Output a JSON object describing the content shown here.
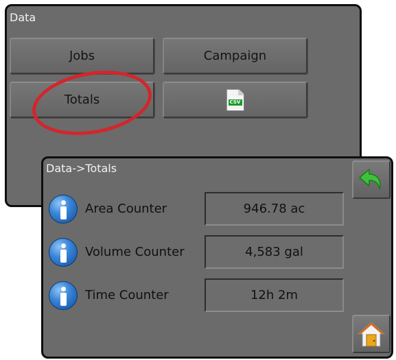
{
  "data_panel": {
    "title": "Data",
    "buttons": {
      "jobs": "Jobs",
      "campaign": "Campaign",
      "totals": "Totals",
      "export": {
        "icon": "csv-file-icon",
        "badge": "CSV"
      }
    },
    "highlight": {
      "target": "Totals",
      "color": "#d2262c"
    }
  },
  "totals_panel": {
    "title": "Data->Totals",
    "rows": [
      {
        "label": "Area Counter",
        "value": "946.78 ac",
        "icon": "info-icon"
      },
      {
        "label": "Volume Counter",
        "value": "4,583 gal",
        "icon": "info-icon"
      },
      {
        "label": "Time Counter",
        "value": "12h 2m",
        "icon": "info-icon"
      }
    ],
    "side_buttons": {
      "back": {
        "icon": "back-arrow-icon",
        "color": "#3fc23a"
      },
      "home": {
        "icon": "home-icon",
        "color": "#e8a81c"
      }
    }
  },
  "colors": {
    "panel_background": "#6b6b6b",
    "panel_border": "#0e0e0e",
    "text": "#141414",
    "title_text": "#f2f2f2"
  }
}
